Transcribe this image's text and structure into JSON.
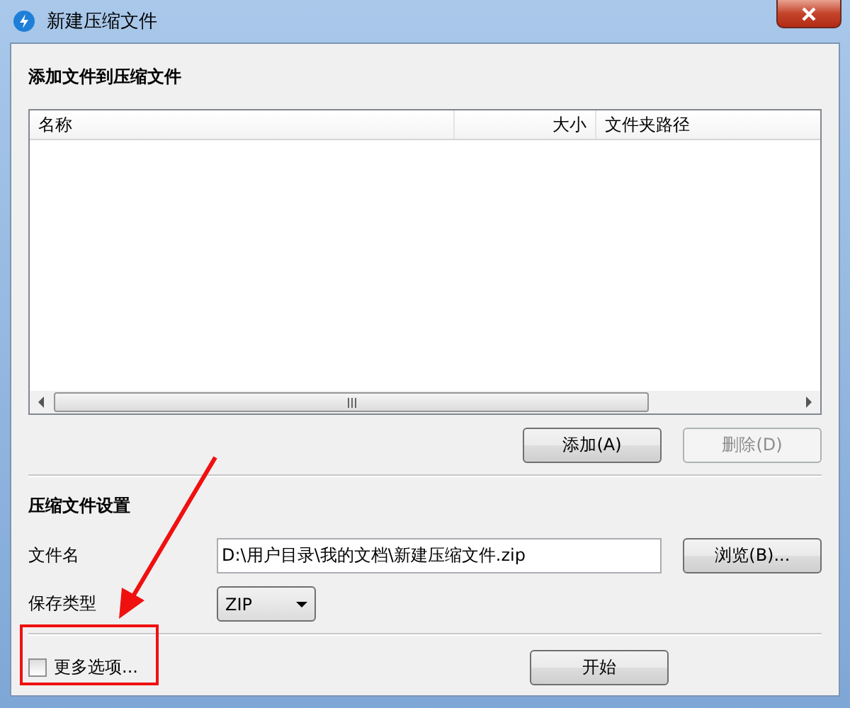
{
  "window": {
    "title": "新建压缩文件"
  },
  "files_section": {
    "heading": "添加文件到压缩文件",
    "columns": [
      "名称",
      "大小",
      "文件夹路径"
    ],
    "buttons": [
      {
        "label": "添加(A)",
        "disabled": false
      },
      {
        "label": "删除(D)",
        "disabled": true
      }
    ]
  },
  "settings_section": {
    "heading": "压缩文件设置",
    "filename_label": "文件名",
    "filename_value": "D:\\用户目录\\我的文档\\新建压缩文件.zip",
    "browse_button": "浏览(B)...",
    "type_label": "保存类型",
    "type_value": "ZIP"
  },
  "more_options": {
    "label": "更多选项...",
    "checked": false
  },
  "start_button": "开始",
  "annotation": {
    "kind": "arrow-box"
  }
}
